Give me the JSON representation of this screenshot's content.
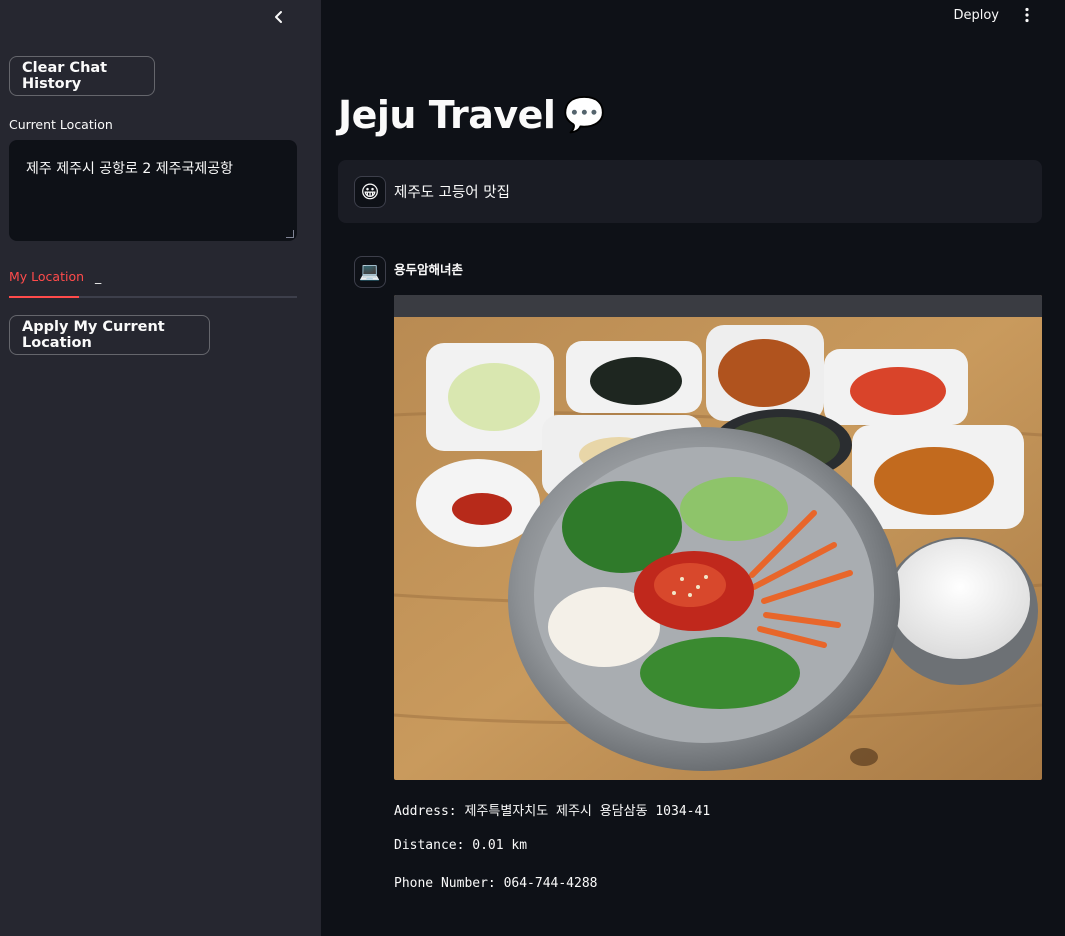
{
  "sidebar": {
    "clear_button": "Clear Chat History",
    "location_label": "Current Location",
    "location_value": "제주 제주시 공항로 2 제주국제공항",
    "tabs": [
      "My Location",
      "_"
    ],
    "apply_button": "Apply My Current Location"
  },
  "header": {
    "deploy_label": "Deploy"
  },
  "main": {
    "title": "Jeju Travel",
    "title_emoji": "💬",
    "user_message": {
      "avatar": "😀",
      "text": "제주도 고등어 맛집"
    },
    "assistant_message": {
      "avatar": "💻",
      "place_name": "용두암해녀촌",
      "address_line": "Address: 제주특별자치도 제주시 용담삼동 1034-41",
      "distance_line": "Distance: 0.01 km",
      "phone_line": "Phone Number: 064-744-4288"
    }
  },
  "colors": {
    "sidebar_bg": "#262730",
    "main_bg": "#0e1117",
    "accent": "#ff4b4b",
    "text": "#fafafa"
  }
}
